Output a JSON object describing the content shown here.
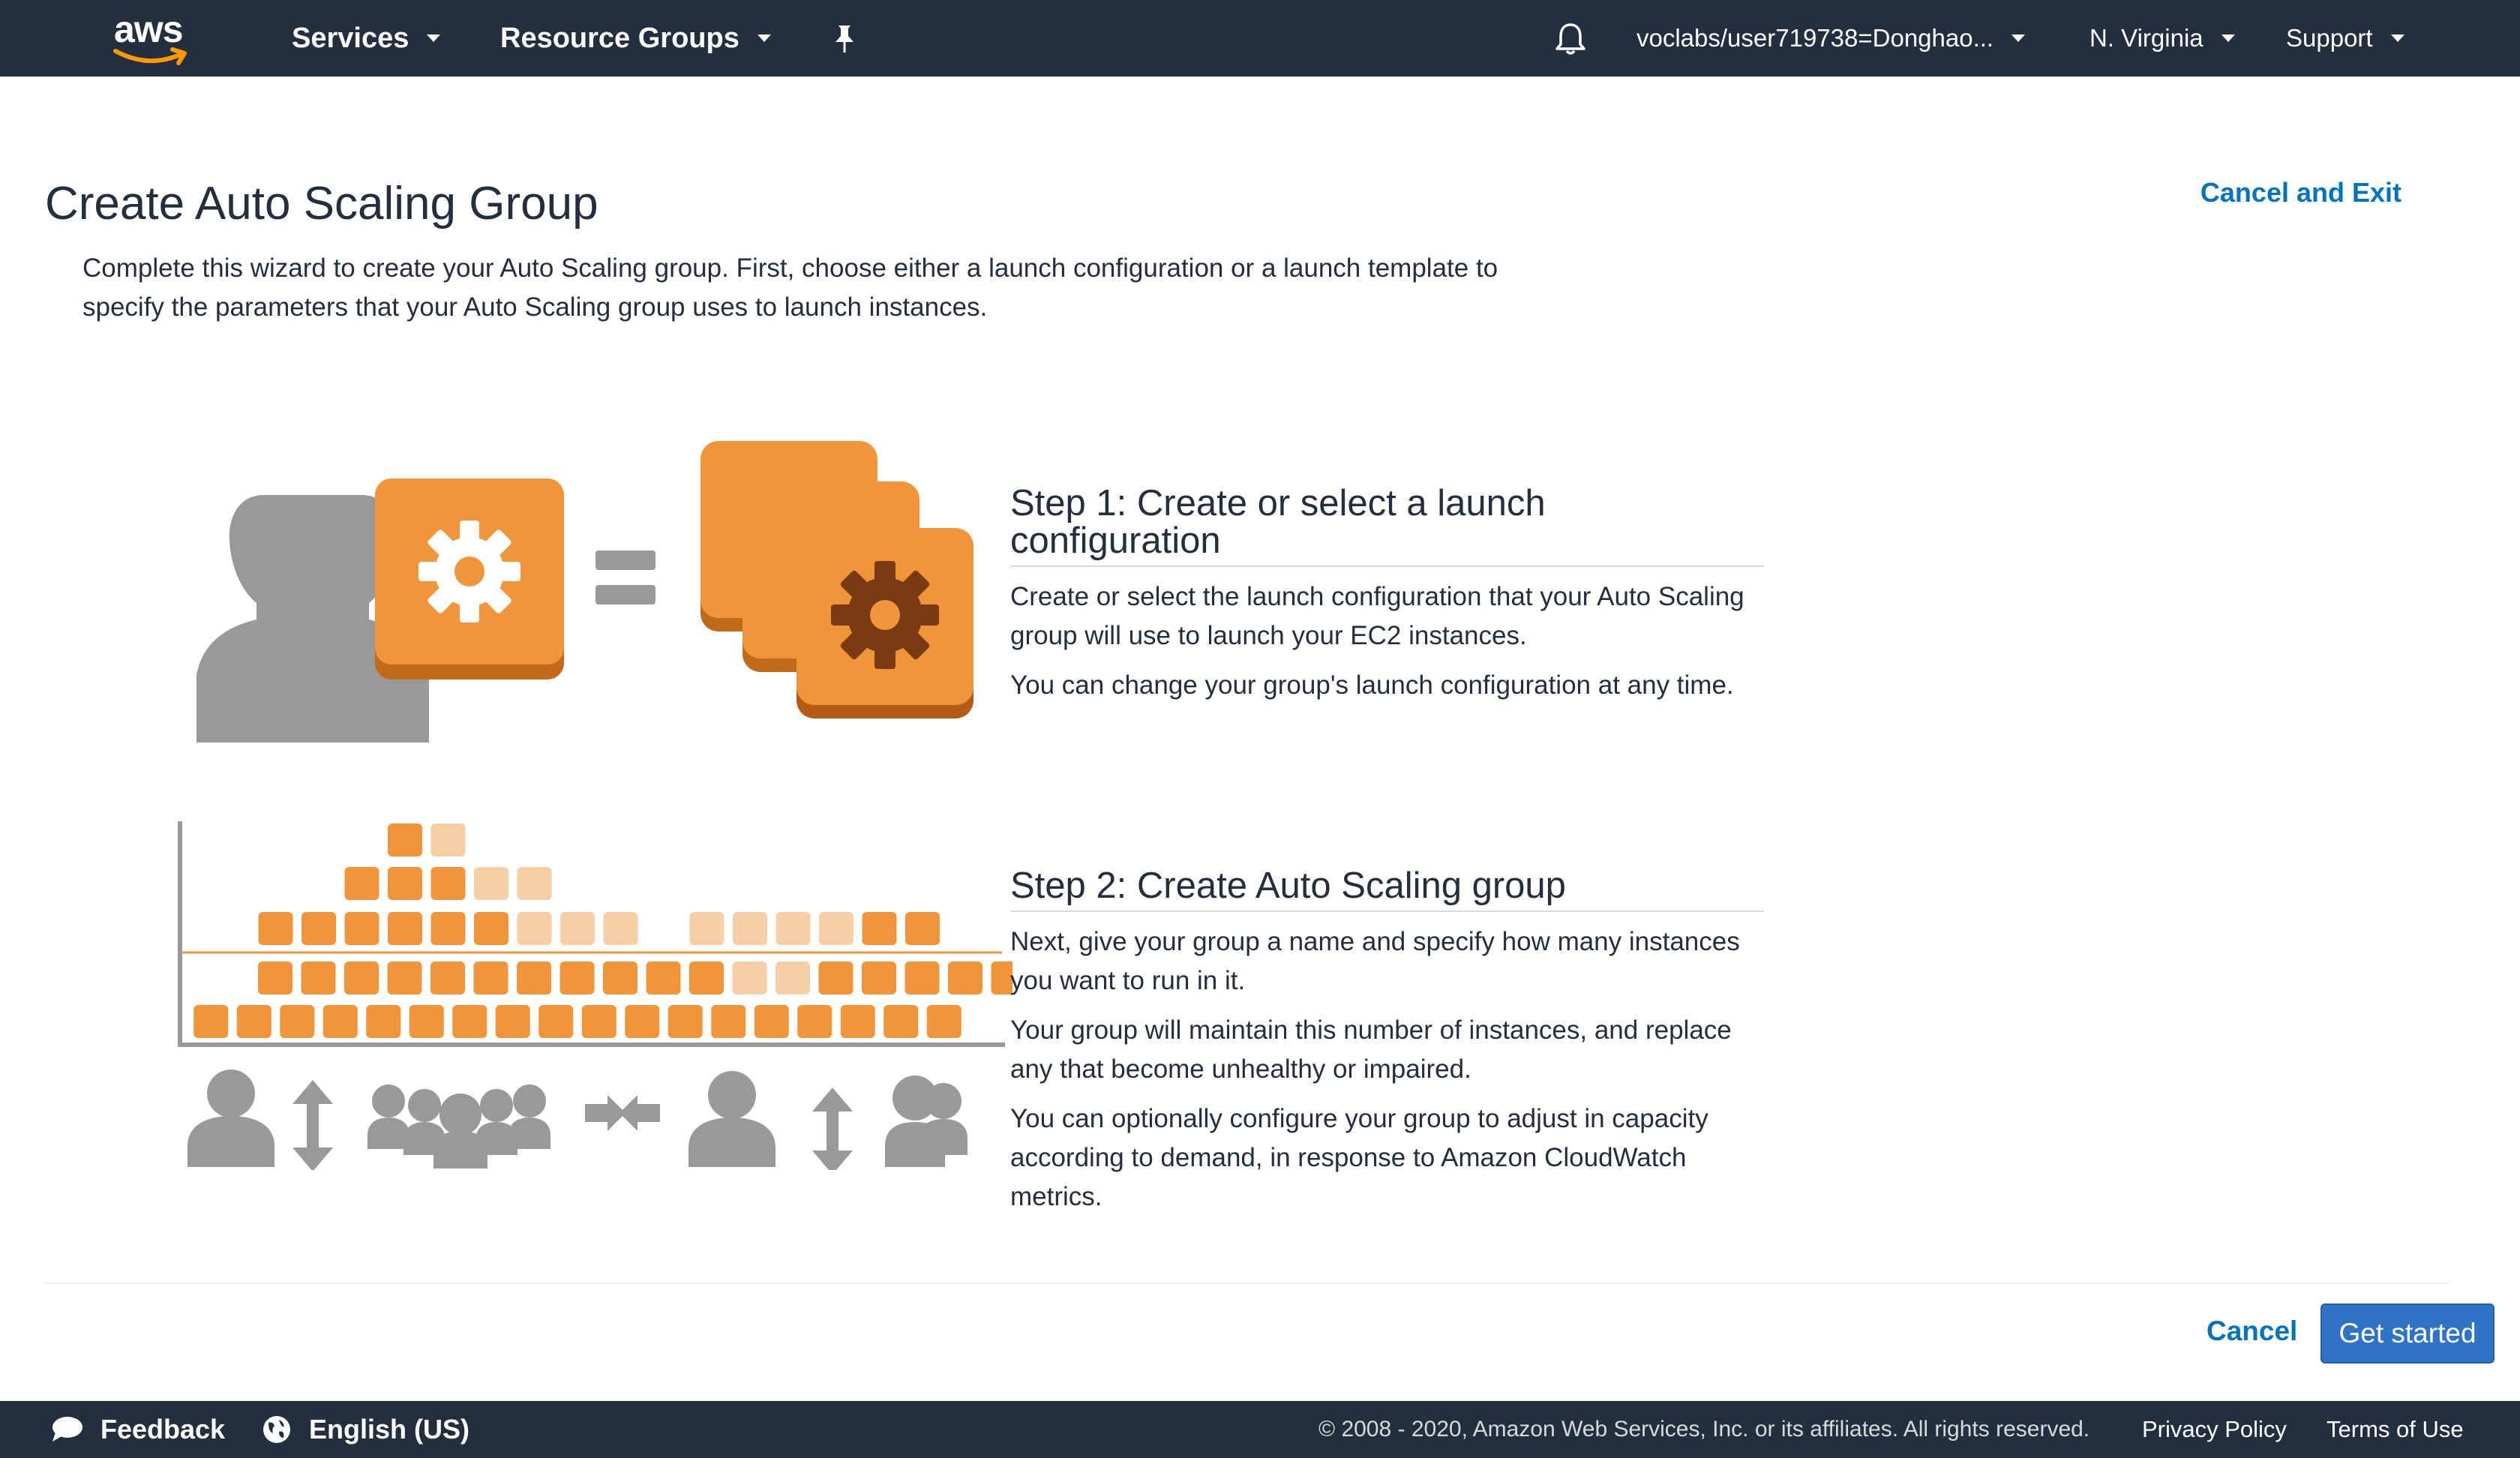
{
  "nav": {
    "logo_text": "aws",
    "services": "Services",
    "resource_groups": "Resource Groups",
    "account": "voclabs/user719738=Donghao...",
    "region": "N. Virginia",
    "support": "Support",
    "icons": [
      "pin-icon",
      "bell-icon"
    ]
  },
  "page": {
    "title": "Create Auto Scaling Group",
    "cancel_exit": "Cancel and Exit",
    "intro": "Complete this wizard to create your Auto Scaling group. First, choose either a launch configuration or a launch template to specify the parameters that your Auto Scaling group uses to launch instances."
  },
  "steps": [
    {
      "title": "Step 1: Create or select a launch configuration",
      "paragraphs": [
        "Create or select the launch configuration that your Auto Scaling group will use to launch your EC2 instances.",
        "You can change your group's launch configuration at any time."
      ]
    },
    {
      "title": "Step 2: Create Auto Scaling group",
      "paragraphs": [
        "Next, give your group a name and specify how many instances you want to run in it.",
        "Your group will maintain this number of instances, and replace any that become unhealthy or impaired.",
        "You can optionally configure your group to adjust in capacity according to demand, in response to Amazon CloudWatch metrics."
      ]
    }
  ],
  "actions": {
    "cancel": "Cancel",
    "get_started": "Get started"
  },
  "footer": {
    "feedback": "Feedback",
    "language": "English (US)",
    "copyright": "© 2008 - 2020, Amazon Web Services, Inc. or its affiliates. All rights reserved.",
    "privacy": "Privacy Policy",
    "terms": "Terms of Use"
  },
  "colors": {
    "nav_bg": "#232f3e",
    "link": "#0073bb",
    "primary_button": "#2f73c4",
    "orange": "#f0953a",
    "orange_light": "#f6cfa6",
    "grey_figure": "#999999"
  }
}
